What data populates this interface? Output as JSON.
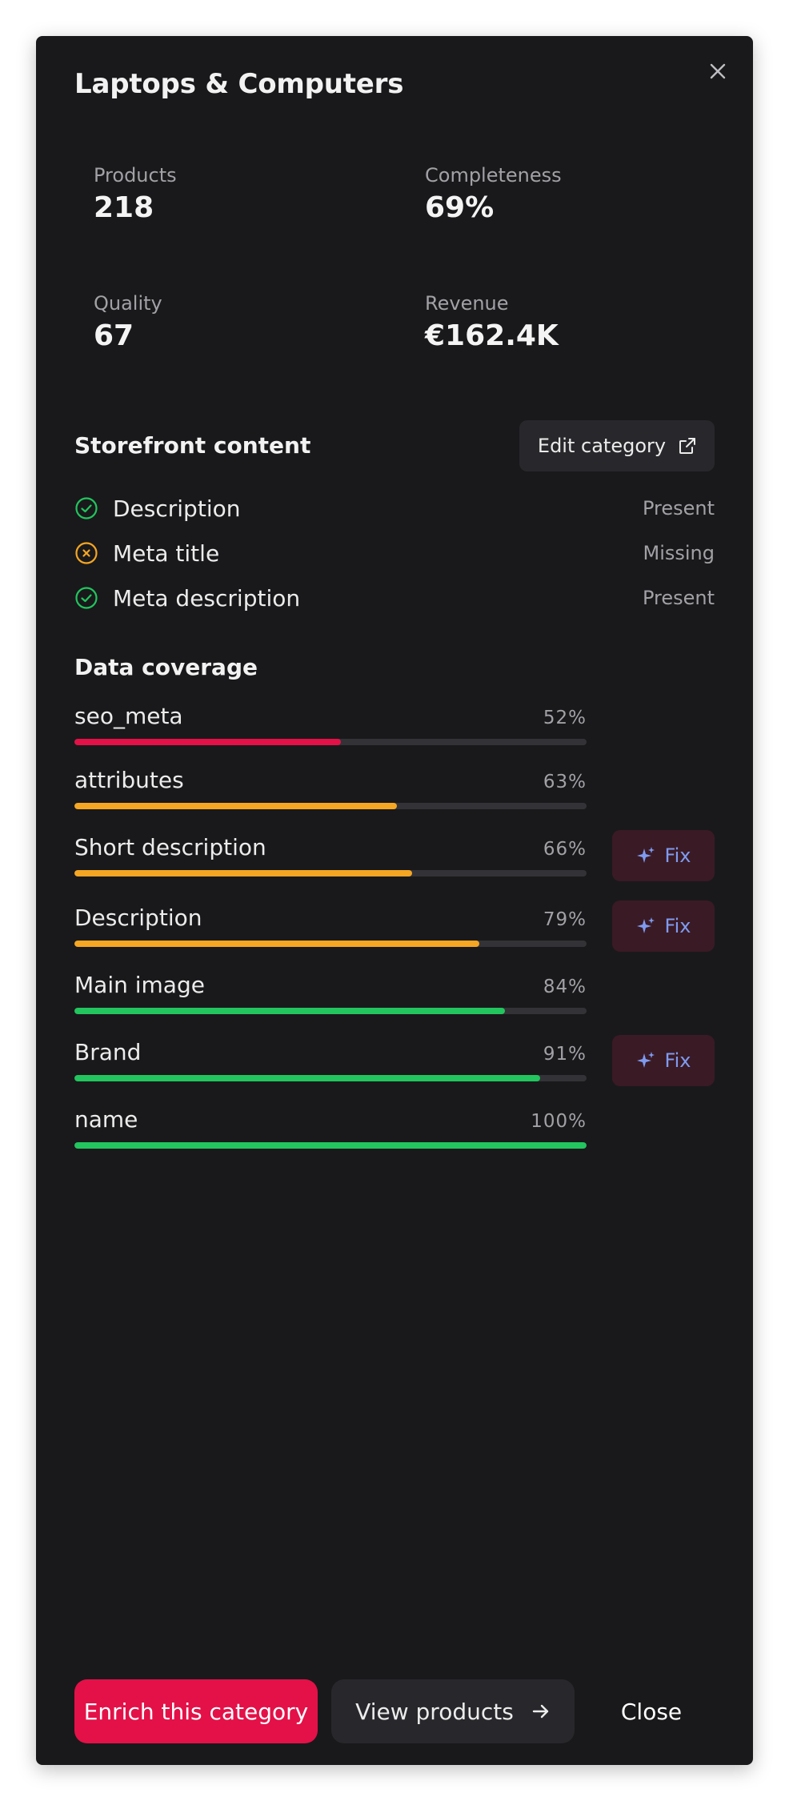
{
  "dialog": {
    "title": "Laptops & Computers"
  },
  "stats": [
    {
      "label": "Products",
      "value": "218"
    },
    {
      "label": "Completeness",
      "value": "69%"
    },
    {
      "label": "Quality",
      "value": "67"
    },
    {
      "label": "Revenue",
      "value": "€162.4K"
    }
  ],
  "storefront": {
    "title": "Storefront content",
    "edit_label": "Edit category",
    "items": [
      {
        "name": "Description",
        "state": "Present",
        "status": "ok"
      },
      {
        "name": "Meta title",
        "state": "Missing",
        "status": "missing"
      },
      {
        "name": "Meta description",
        "state": "Present",
        "status": "ok"
      }
    ]
  },
  "coverage": {
    "title": "Data coverage",
    "fix_label": "Fix",
    "items": [
      {
        "name": "seo_meta",
        "pct": "52%",
        "value": 0.52,
        "color": "#e31148",
        "fix": false
      },
      {
        "name": "attributes",
        "pct": "63%",
        "value": 0.63,
        "color": "#f5a623",
        "fix": false
      },
      {
        "name": "Short description",
        "pct": "66%",
        "value": 0.66,
        "color": "#f5a623",
        "fix": true
      },
      {
        "name": "Description",
        "pct": "79%",
        "value": 0.79,
        "color": "#f5a623",
        "fix": true
      },
      {
        "name": "Main image",
        "pct": "84%",
        "value": 0.84,
        "color": "#22c55e",
        "fix": false
      },
      {
        "name": "Brand",
        "pct": "91%",
        "value": 0.91,
        "color": "#22c55e",
        "fix": true
      },
      {
        "name": "name",
        "pct": "100%",
        "value": 1.0,
        "color": "#22c55e",
        "fix": false
      }
    ]
  },
  "footer": {
    "primary_label": "Enrich this category",
    "secondary_label": "View products",
    "close_label": "Close"
  },
  "colors": {
    "ok": "#22c55e",
    "missing": "#f5a623",
    "accent": "#e31148",
    "fix_text": "#7e9bf0"
  },
  "icons": {
    "close": "close-icon",
    "external_link": "external-link-icon",
    "check_circle": "check-circle-icon",
    "x_circle": "x-circle-icon",
    "sparkles": "sparkles-icon",
    "arrow_right": "arrow-right-icon"
  }
}
